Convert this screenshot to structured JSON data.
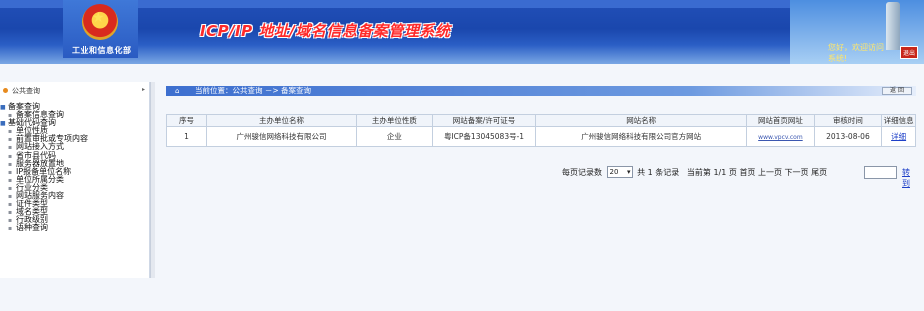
{
  "header": {
    "ministry_name": "工业和信息化部",
    "system_title": "ICP/IP 地址/域名信息备案管理系统",
    "welcome_line1": "您好，欢迎访问",
    "welcome_line2": "系统!",
    "exit_label": "退出"
  },
  "sidebar": {
    "title": "公共查询",
    "items": [
      {
        "label": "备案查询",
        "level": 0
      },
      {
        "label": "备案信息查询",
        "level": 1
      },
      {
        "label": "基础代码查询",
        "level": 0
      },
      {
        "label": "单位性质",
        "level": 1
      },
      {
        "label": "前置审批或专项内容",
        "level": 1
      },
      {
        "label": "网站接入方式",
        "level": 1
      },
      {
        "label": "省市县代码",
        "level": 1
      },
      {
        "label": "服务器放置地",
        "level": 1
      },
      {
        "label": "IP报备单位名称",
        "level": 1
      },
      {
        "label": "单位所属分类",
        "level": 1
      },
      {
        "label": "行业分类",
        "level": 1
      },
      {
        "label": "网站服务内容",
        "level": 1
      },
      {
        "label": "证件类型",
        "level": 1
      },
      {
        "label": "域名类型",
        "level": 1
      },
      {
        "label": "行政级别",
        "level": 1
      },
      {
        "label": "语种查询",
        "level": 1
      }
    ]
  },
  "breadcrumb": {
    "text": "当前位置：公共查询 －> 备案查询",
    "back_label": "返 回"
  },
  "table": {
    "columns": [
      "序号",
      "主办单位名称",
      "主办单位性质",
      "网站备案/许可证号",
      "网站名称",
      "网站首页网址",
      "审核时间",
      "详细信息"
    ],
    "rows": [
      {
        "index": "1",
        "org_name": "广州骏信网络科技有限公司",
        "org_type": "企业",
        "license": "粤ICP备13045083号-1",
        "site_name": "广州骏信网络科技有限公司官方网站",
        "url": "www.vpcv.com",
        "date": "2013-08-06",
        "detail": "详细"
      }
    ]
  },
  "pager": {
    "per_page_label": "每页记录数",
    "per_page_value": "20",
    "total_label": "共 1 条记录",
    "current_label": "当前第 1/1 页",
    "first": "首页",
    "prev": "上一页",
    "next": "下一页",
    "last": "尾页",
    "jump_label": "转到"
  }
}
